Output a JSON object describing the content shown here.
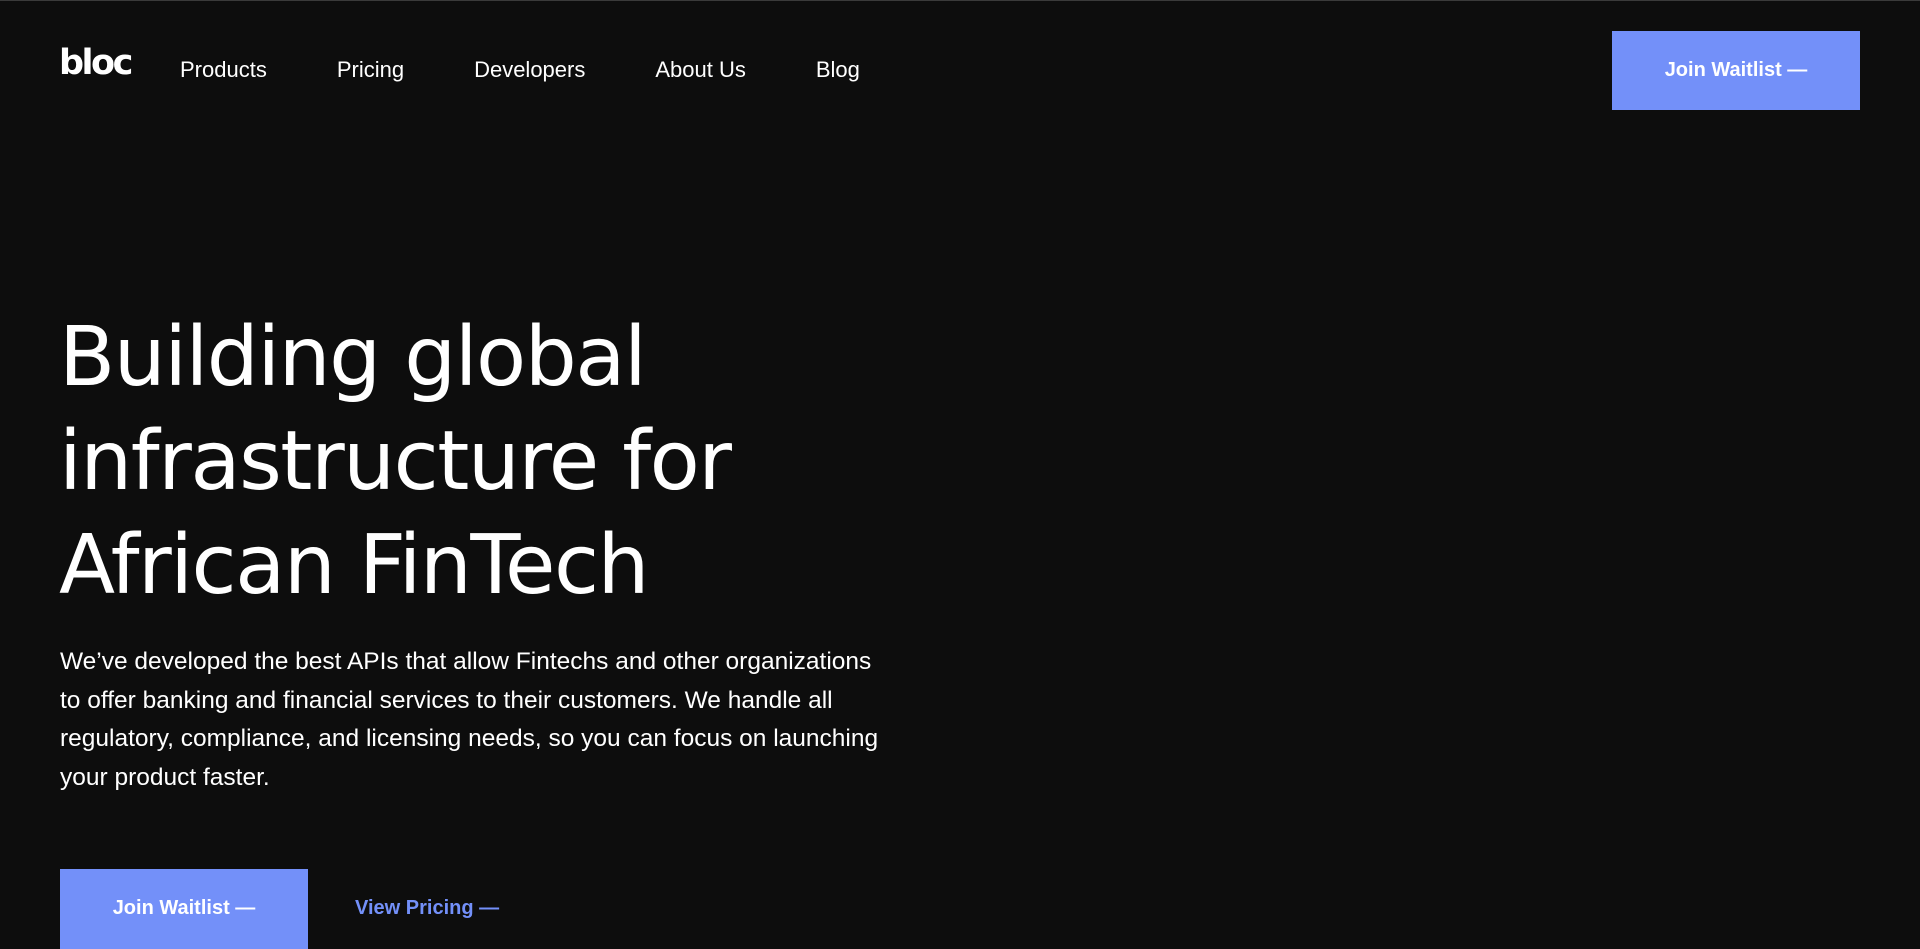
{
  "header": {
    "logo": "bloc",
    "nav": [
      "Products",
      "Pricing",
      "Developers",
      "About Us",
      "Blog"
    ],
    "cta_label": "Join Waitlist —"
  },
  "hero": {
    "title_lines": [
      "Building global",
      "infrastructure for",
      "African FinTech"
    ],
    "description_lines": [
      "We’ve developed the best APIs that allow Fintechs and other organizations",
      "to offer banking and financial services to their customers. We handle all",
      "regulatory, compliance, and licensing needs, so you can focus on launching",
      "your product faster."
    ],
    "primary_cta": "Join Waitlist —",
    "secondary_cta": "View Pricing —"
  },
  "colors": {
    "background": "#0d0d0d",
    "accent": "#7390f9",
    "text": "#ffffff"
  }
}
